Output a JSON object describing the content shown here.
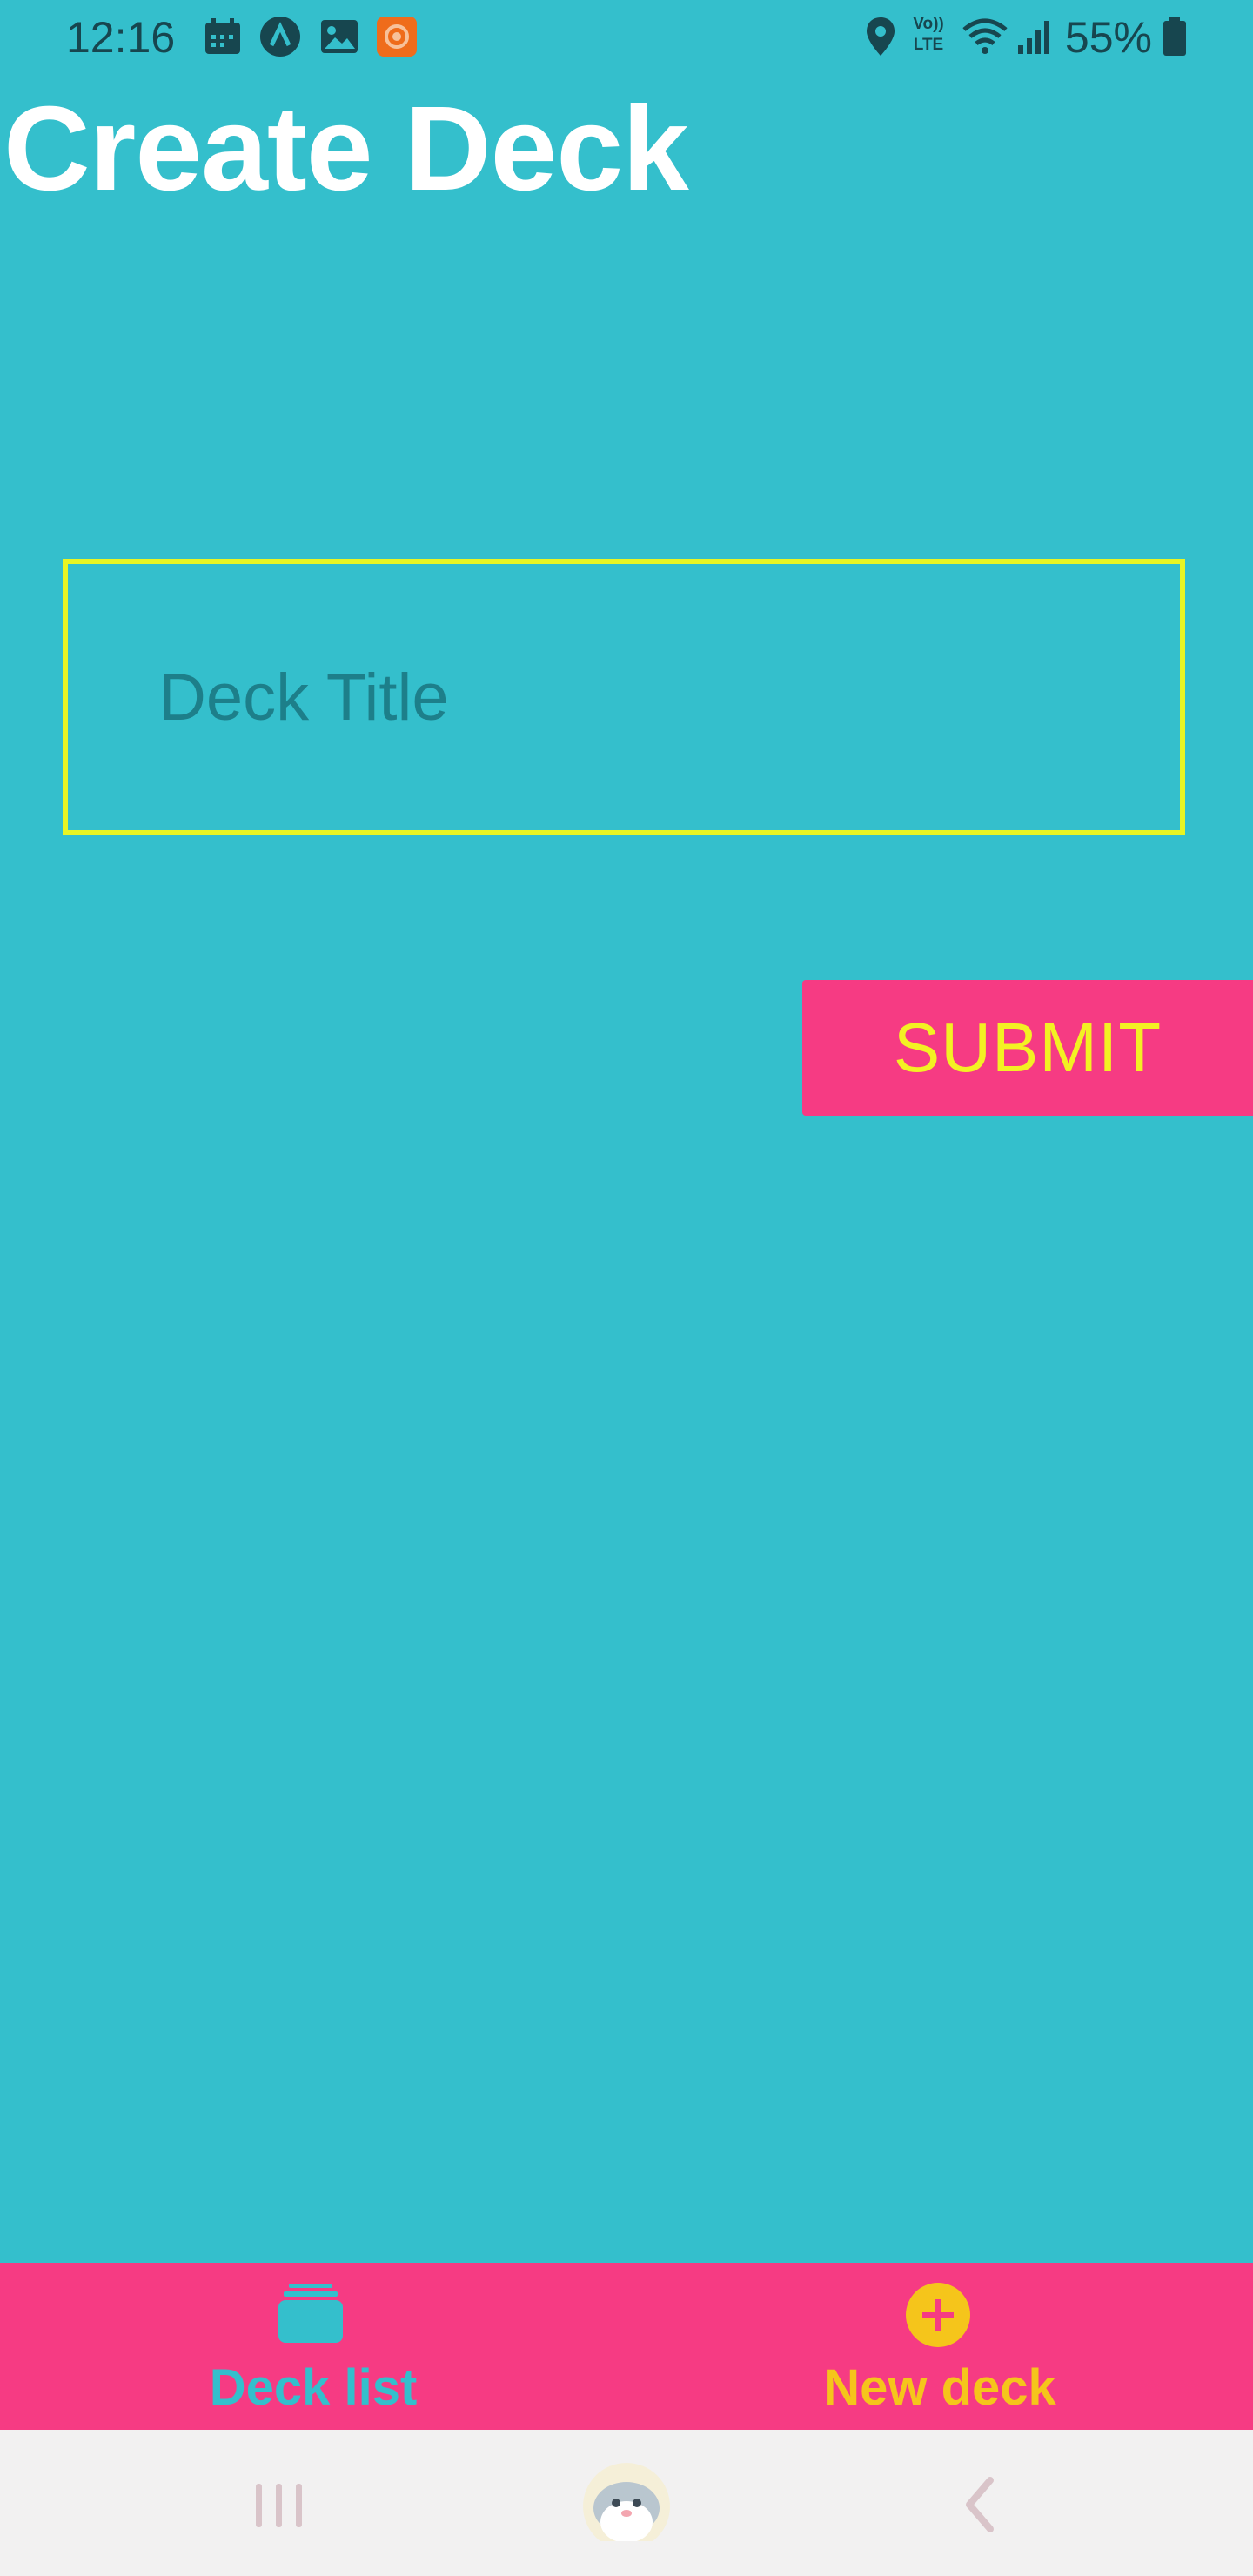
{
  "status_bar": {
    "time": "12:16",
    "battery": "55%",
    "icons": [
      "calendar-icon",
      "app-a-icon",
      "gallery-icon",
      "recorder-icon",
      "location-icon",
      "volte-icon",
      "wifi-icon",
      "signal-icon",
      "battery-icon"
    ],
    "volte_label": "Vo)) LTE"
  },
  "header": {
    "title": "Create Deck"
  },
  "form": {
    "deck_title_placeholder": "Deck Title",
    "deck_title_value": "",
    "submit_label": "SUBMIT"
  },
  "tabs": [
    {
      "label": "Deck list",
      "icon": "stack-icon",
      "color": "#34bfcc"
    },
    {
      "label": "New deck",
      "icon": "plus-circle-icon",
      "color": "#f5c51b"
    }
  ],
  "nav_bar": {
    "items": [
      "recents-icon",
      "home-icon",
      "back-icon"
    ]
  },
  "colors": {
    "background": "#34bfcc",
    "accent": "#f63b83",
    "input_border": "#e8f523",
    "button_text": "#f3f123"
  }
}
